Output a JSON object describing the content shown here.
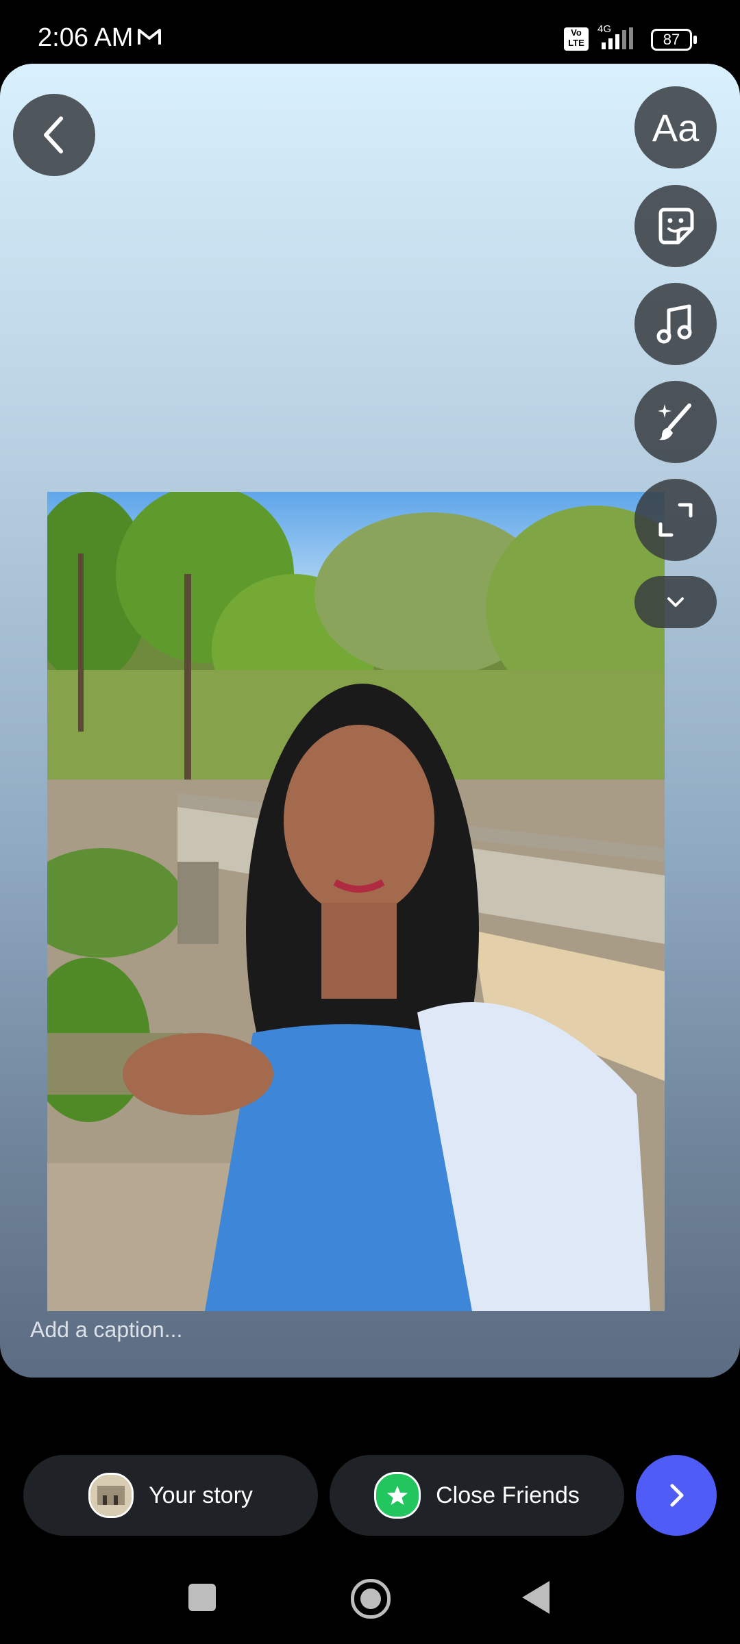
{
  "status_bar": {
    "time": "2:06 AM",
    "network": "4G",
    "volte": "Vo LTE",
    "battery": "87"
  },
  "caption": {
    "placeholder": "Add a caption..."
  },
  "side_tools": {
    "text_tool_label": "Aa"
  },
  "share": {
    "your_story_label": "Your story",
    "close_friends_label": "Close Friends"
  },
  "icons": {
    "back": "chevron-left-icon",
    "sticker": "sticker-icon",
    "music": "music-note-icon",
    "draw": "magic-brush-icon",
    "expand": "expand-icon",
    "more": "chevron-down-icon",
    "next": "chevron-right-icon"
  },
  "colors": {
    "next_button": "#4f5cf6",
    "close_friends_star": "#22c55e",
    "pill_bg": "#1f2226"
  }
}
